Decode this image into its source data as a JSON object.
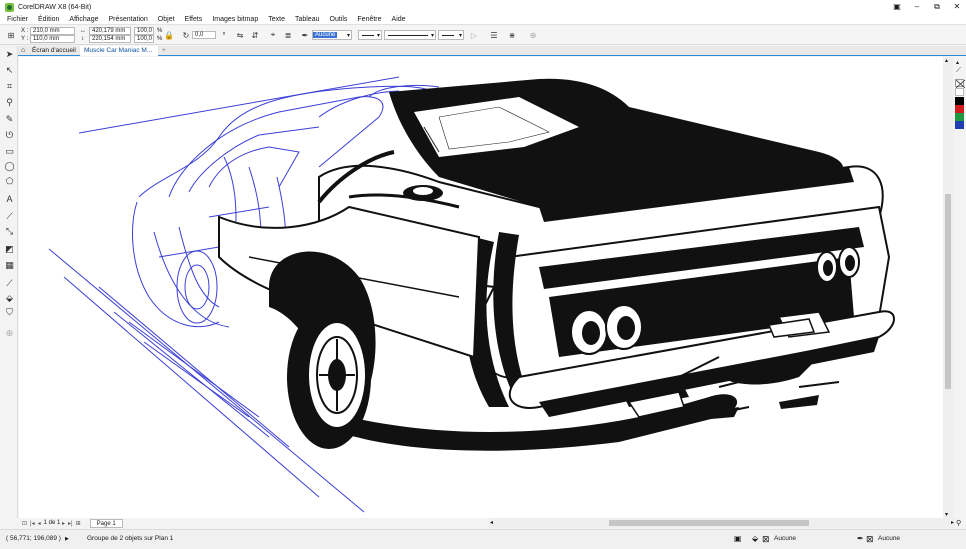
{
  "window": {
    "title": "CorelDRAW X8 (64-Bit)",
    "controls": [
      "▣",
      "–",
      "⧉",
      "✕"
    ]
  },
  "menu": [
    "Fichier",
    "Édition",
    "Affichage",
    "Présentation",
    "Objet",
    "Effets",
    "Images bitmap",
    "Texte",
    "Tableau",
    "Outils",
    "Fenêtre",
    "Aide"
  ],
  "propbar": {
    "x_label": "X :",
    "y_label": "Y :",
    "x_value": "210,0 mm",
    "y_value": "110,0 mm",
    "width_value": "420,179 mm",
    "height_value": "220,154 mm",
    "scale_x": "100,0",
    "scale_y": "100,0",
    "percent": "%",
    "rotation": "0,0",
    "outline_width": "Aucune"
  },
  "tabs": {
    "home": "Écran d'accueil",
    "document": "Muscle Car Maniac M...",
    "add": "+"
  },
  "pagenav": {
    "current": "1",
    "of": "de",
    "total": "1",
    "page_tab": "Page 1"
  },
  "status": {
    "coords": "( 56,771; 196,089 )",
    "arrow": "▶",
    "selection": "Groupe de 2 objets sur Plan 1",
    "fill_label": "Aucune",
    "outline_label": "Aucune"
  },
  "palette": {
    "colors": [
      "#ffffff",
      "#000000",
      "#d01c1c",
      "#1f9a43",
      "#1f3fb0"
    ]
  }
}
